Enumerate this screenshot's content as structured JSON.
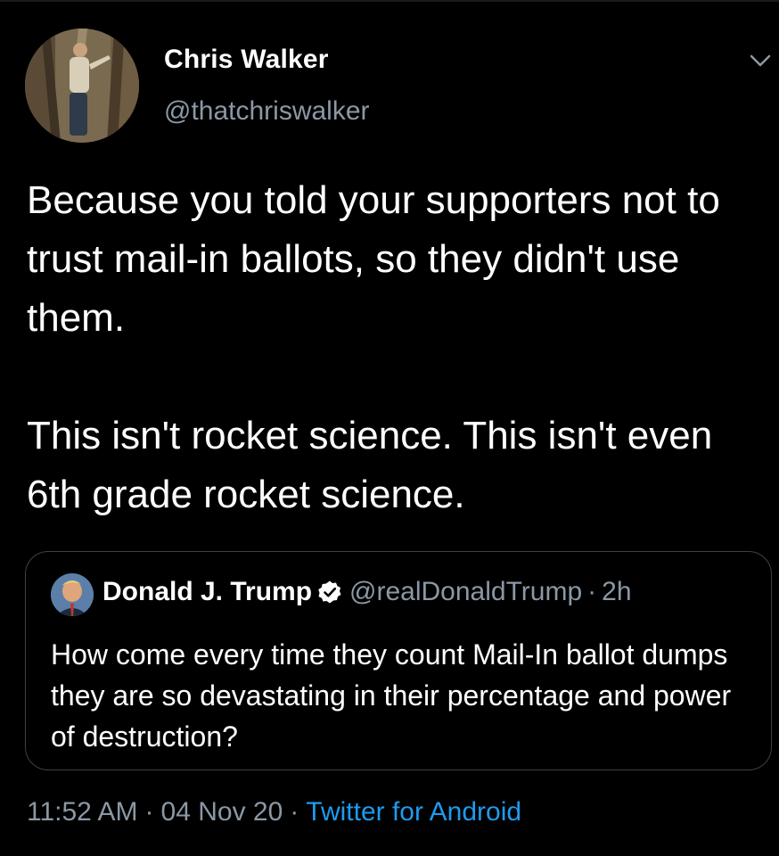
{
  "tweet": {
    "author": {
      "display_name": "Chris Walker",
      "handle": "@thatchriswalker"
    },
    "text_paragraphs": [
      "Because you told your supporters not to trust mail-in ballots, so they didn't use them.",
      "This isn't rocket science. This isn't even 6th grade rocket science."
    ],
    "quoted": {
      "display_name": "Donald J. Trump",
      "handle": "@realDonaldTrump",
      "separator": "·",
      "age": "2h",
      "text": "How come every time they count Mail-In ballot dumps they are so devastating in their percentage and power of destruction?"
    },
    "meta": {
      "time": "11:52 AM",
      "separator": "·",
      "date": "04 Nov 20",
      "source": "Twitter for Android"
    }
  },
  "icons": {
    "menu": "chevron-down-icon",
    "verified": "verified-badge-icon"
  },
  "colors": {
    "background": "#000000",
    "text": "#ffffff",
    "muted": "#8b98a5",
    "accent": "#1d9bf0",
    "border": "#3d4246"
  }
}
